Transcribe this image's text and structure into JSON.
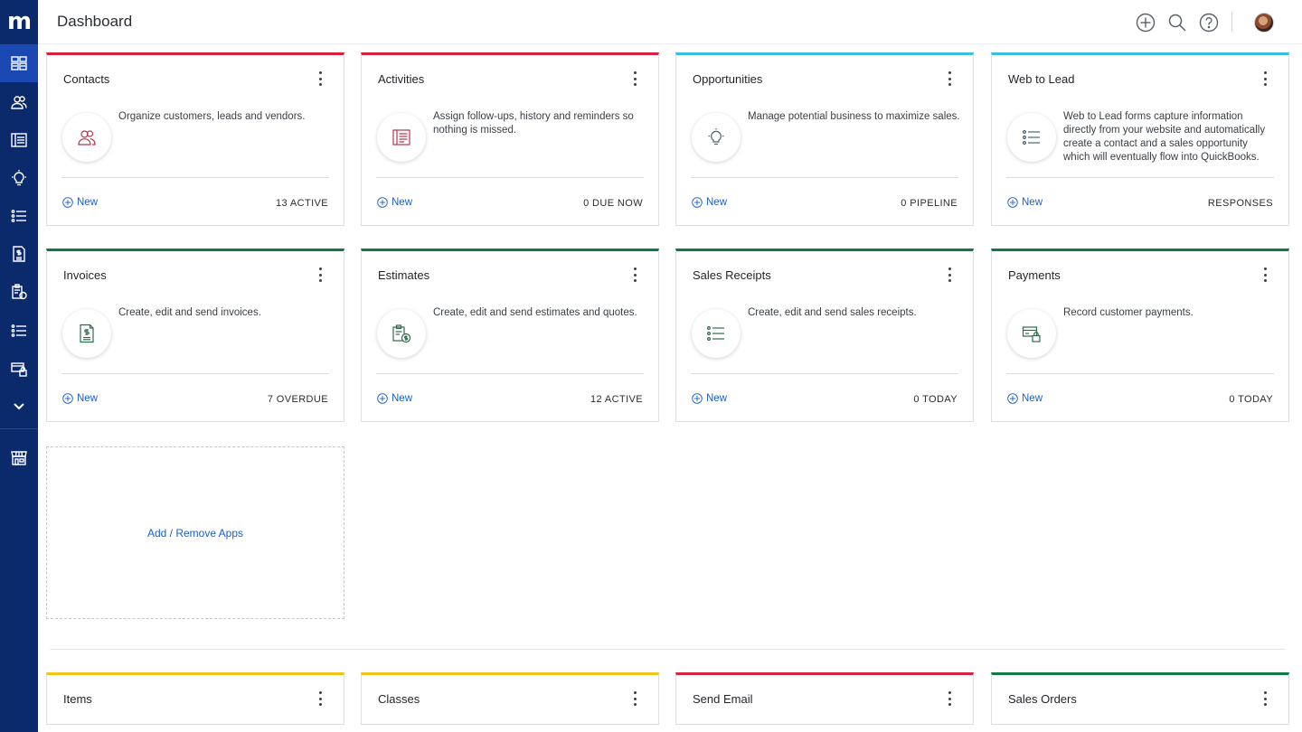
{
  "header": {
    "title": "Dashboard"
  },
  "sidebar": {
    "logo": "m",
    "items": [
      {
        "name": "dashboard",
        "icon": "dashboard-icon",
        "active": true
      },
      {
        "name": "contacts",
        "icon": "people-icon"
      },
      {
        "name": "activities",
        "icon": "notebook-icon"
      },
      {
        "name": "opportunities",
        "icon": "lightbulb-icon"
      },
      {
        "name": "list",
        "icon": "list-icon"
      },
      {
        "name": "invoices",
        "icon": "invoice-icon"
      },
      {
        "name": "estimates",
        "icon": "clipboard-dollar-icon"
      },
      {
        "name": "sales-receipts",
        "icon": "list-icon"
      },
      {
        "name": "payments",
        "icon": "card-lock-icon"
      },
      {
        "name": "more",
        "icon": "chevron-down-icon"
      },
      {
        "name": "marketplace",
        "icon": "store-icon"
      }
    ]
  },
  "cards": [
    {
      "title": "Contacts",
      "desc": "Organize customers, leads and vendors.",
      "new": "New",
      "stat": "13 ACTIVE",
      "color": "#d6223f",
      "icon": "people-icon"
    },
    {
      "title": "Activities",
      "desc": "Assign follow-ups, history and reminders so nothing is missed.",
      "new": "New",
      "stat": "0 DUE NOW",
      "color": "#d6223f",
      "icon": "notebook-icon"
    },
    {
      "title": "Opportunities",
      "desc": "Manage potential business to maximize sales.",
      "new": "New",
      "stat": "0 PIPELINE",
      "color": "#3bbde0",
      "icon": "lightbulb-icon"
    },
    {
      "title": "Web to Lead",
      "desc": "Web to Lead forms capture information directly from your website and automatically create a contact and a sales opportunity which will eventually flow into QuickBooks.",
      "new": "New",
      "stat": "RESPONSES",
      "color": "#3bbde0",
      "icon": "list-icon"
    },
    {
      "title": "Invoices",
      "desc": "Create, edit and send invoices.",
      "new": "New",
      "stat": "7 OVERDUE",
      "color": "#0f7a43",
      "icon": "invoice-icon"
    },
    {
      "title": "Estimates",
      "desc": "Create, edit and send estimates and quotes.",
      "new": "New",
      "stat": "12 ACTIVE",
      "color": "#0f7a43",
      "icon": "clipboard-dollar-icon"
    },
    {
      "title": "Sales Receipts",
      "desc": "Create, edit and send sales receipts.",
      "new": "New",
      "stat": "0 TODAY",
      "color": "#0f7a43",
      "icon": "list-icon"
    },
    {
      "title": "Payments",
      "desc": "Record customer payments.",
      "new": "New",
      "stat": "0 TODAY",
      "color": "#0f7a43",
      "icon": "card-lock-icon"
    }
  ],
  "add_apps": "Add / Remove Apps",
  "bottom_cards": [
    {
      "title": "Items",
      "color": "#f2c318"
    },
    {
      "title": "Classes",
      "color": "#f2c318"
    },
    {
      "title": "Send Email",
      "color": "#d6223f"
    },
    {
      "title": "Sales Orders",
      "color": "#0f7a43"
    }
  ]
}
